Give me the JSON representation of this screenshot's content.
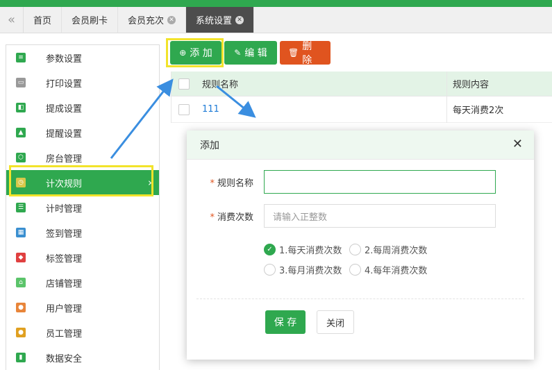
{
  "tabs": {
    "collapse_icon": "«",
    "items": [
      {
        "label": "首页",
        "closable": false,
        "active": false
      },
      {
        "label": "会员刷卡",
        "closable": false,
        "active": false
      },
      {
        "label": "会员充次",
        "closable": true,
        "active": false
      },
      {
        "label": "系统设置",
        "closable": true,
        "active": true
      }
    ],
    "close_glyph": "✕"
  },
  "sidebar": {
    "items": [
      {
        "label": "参数设置",
        "icon": "sliders-icon",
        "color": "#2fa84f"
      },
      {
        "label": "打印设置",
        "icon": "printer-icon",
        "color": "#999999"
      },
      {
        "label": "提成设置",
        "icon": "commission-icon",
        "color": "#2fa84f"
      },
      {
        "label": "提醒设置",
        "icon": "bell-icon",
        "color": "#2fa84f"
      },
      {
        "label": "房台管理",
        "icon": "room-icon",
        "color": "#2fa84f"
      },
      {
        "label": "计次规则",
        "icon": "alarm-clock-icon",
        "color": "#d8c84a",
        "active": true
      },
      {
        "label": "计时管理",
        "icon": "timer-icon",
        "color": "#2fa84f"
      },
      {
        "label": "签到管理",
        "icon": "calendar-icon",
        "color": "#3a8fd0"
      },
      {
        "label": "标签管理",
        "icon": "tag-icon",
        "color": "#e04040"
      },
      {
        "label": "店铺管理",
        "icon": "store-icon",
        "color": "#5bc46a"
      },
      {
        "label": "用户管理",
        "icon": "user-icon",
        "color": "#e8853a"
      },
      {
        "label": "员工管理",
        "icon": "staff-icon",
        "color": "#e0a020"
      },
      {
        "label": "数据安全",
        "icon": "chart-icon",
        "color": "#2fa84f"
      }
    ],
    "chevron": "›"
  },
  "toolbar": {
    "add_label": "添 加",
    "edit_label": "编 辑",
    "delete_label": "删 除",
    "add_icon": "⊕",
    "edit_icon": "✎",
    "delete_icon": "🗑"
  },
  "table": {
    "headers": [
      "规则名称",
      "规则内容"
    ],
    "rows": [
      {
        "name": "111",
        "content": "每天消费2次"
      }
    ]
  },
  "dialog": {
    "title": "添加",
    "close_glyph": "✕",
    "required_mark": "*",
    "name_label": "规则名称",
    "name_value": "",
    "count_label": "消费次数",
    "count_placeholder": "请输入正整数",
    "options": [
      {
        "label": "1.每天消费次数",
        "selected": true
      },
      {
        "label": "2.每周消费次数",
        "selected": false
      },
      {
        "label": "3.每月消费次数",
        "selected": false
      },
      {
        "label": "4.每年消费次数",
        "selected": false
      }
    ],
    "check_glyph": "✓",
    "save_label": "保 存",
    "close_label": "关闭"
  },
  "colors": {
    "accent": "#2fa84f",
    "danger": "#e0541f",
    "highlight": "#f2e32a",
    "arrow": "#3a8ee0"
  }
}
